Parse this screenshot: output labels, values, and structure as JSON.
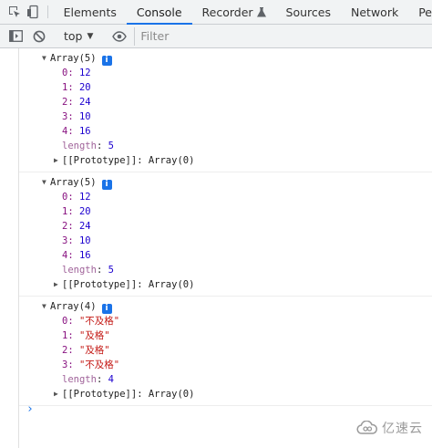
{
  "tabs": [
    "Elements",
    "Console",
    "Recorder",
    "Sources",
    "Network",
    "Pe"
  ],
  "active_tab": "Console",
  "toolbar": {
    "context": "top",
    "filter_placeholder": "Filter"
  },
  "entries": [
    {
      "header": "Array(5)",
      "items": [
        {
          "key": "0",
          "value": "12",
          "type": "num"
        },
        {
          "key": "1",
          "value": "20",
          "type": "num"
        },
        {
          "key": "2",
          "value": "24",
          "type": "num"
        },
        {
          "key": "3",
          "value": "10",
          "type": "num"
        },
        {
          "key": "4",
          "value": "16",
          "type": "num"
        }
      ],
      "length": "5",
      "prototype": "Array(0)"
    },
    {
      "header": "Array(5)",
      "items": [
        {
          "key": "0",
          "value": "12",
          "type": "num"
        },
        {
          "key": "1",
          "value": "20",
          "type": "num"
        },
        {
          "key": "2",
          "value": "24",
          "type": "num"
        },
        {
          "key": "3",
          "value": "10",
          "type": "num"
        },
        {
          "key": "4",
          "value": "16",
          "type": "num"
        }
      ],
      "length": "5",
      "prototype": "Array(0)"
    },
    {
      "header": "Array(4)",
      "items": [
        {
          "key": "0",
          "value": "\"不及格\"",
          "type": "str"
        },
        {
          "key": "1",
          "value": "\"及格\"",
          "type": "str"
        },
        {
          "key": "2",
          "value": "\"及格\"",
          "type": "str"
        },
        {
          "key": "3",
          "value": "\"不及格\"",
          "type": "str"
        }
      ],
      "length": "4",
      "prototype": "Array(0)"
    }
  ],
  "labels": {
    "length": "length",
    "prototype": "[[Prototype]]"
  },
  "prompt_symbol": "›",
  "watermark": "亿速云",
  "colors": {
    "key": "#881280",
    "number": "#1c00cf",
    "string": "#c41a16",
    "accent": "#1a73e8"
  }
}
